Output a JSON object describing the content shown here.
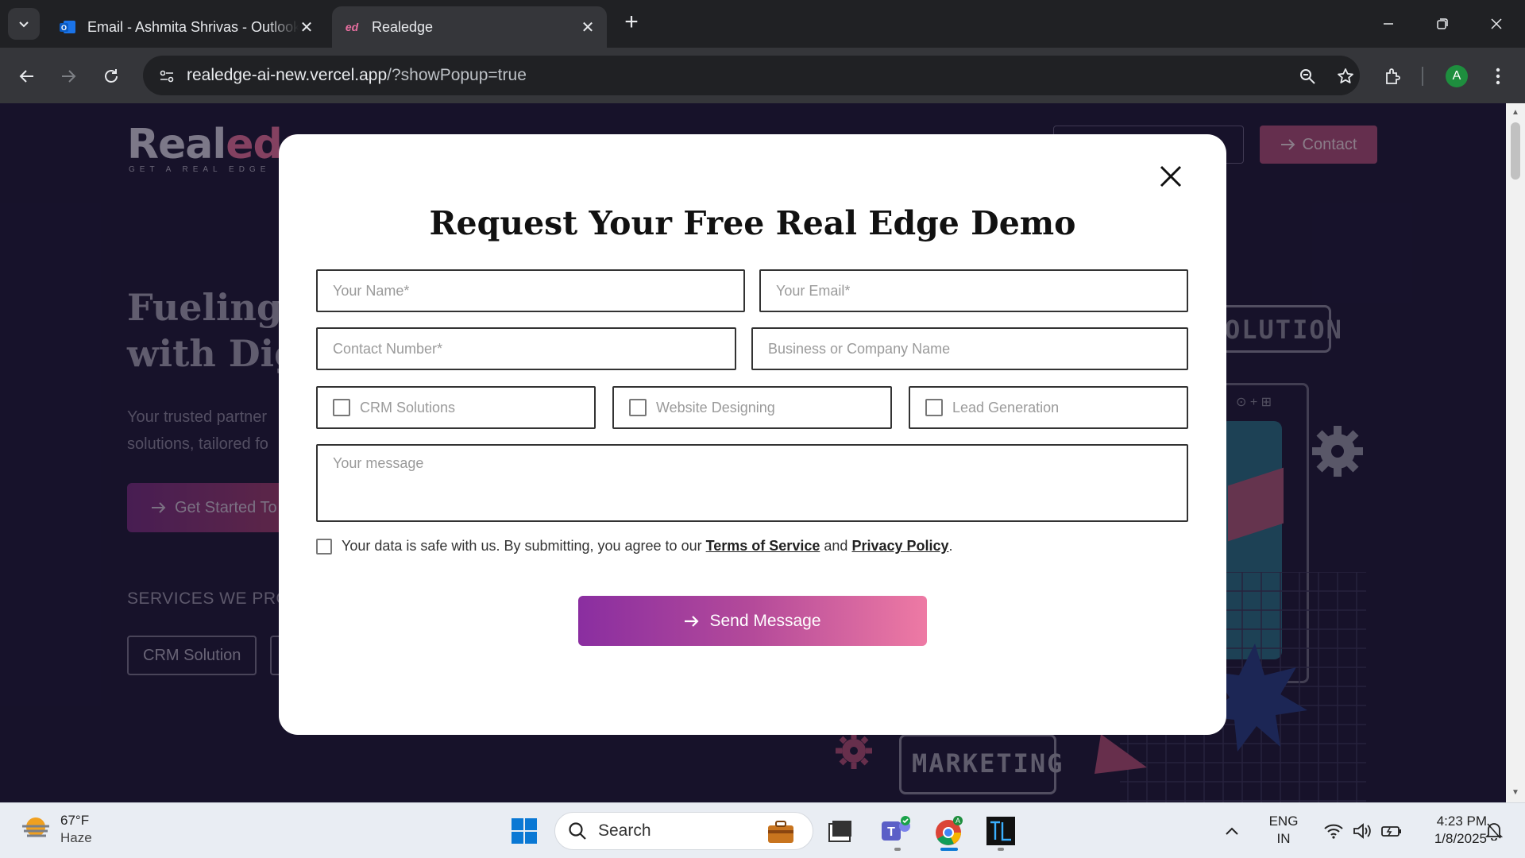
{
  "browser": {
    "tabs": [
      {
        "title": "Email - Ashmita Shrivas - Outlook",
        "active": false
      },
      {
        "title": "Realedge",
        "active": true
      }
    ],
    "url_host": "realedge-ai-new.vercel.app",
    "url_rest": "/?showPopup=true",
    "profile_initial": "A"
  },
  "site": {
    "logo_main": "Real",
    "logo_accent": "edge",
    "logo_tagline": "GET A REAL EDGE",
    "contact_label": "Contact",
    "hero_title_line1": "Fueling B",
    "hero_title_line2": "with Digi",
    "hero_sub_line1": "Your trusted partner",
    "hero_sub_line2": "solutions, tailored fo",
    "get_started_label": "Get Started To",
    "services_heading": "SERVICES WE PROV",
    "service_chip": "CRM Solution",
    "deco_solution": "OLUTION",
    "deco_marketing": "MARKETING"
  },
  "modal": {
    "title": "Request Your Free Real Edge Demo",
    "name_placeholder": "Your Name*",
    "email_placeholder": "Your Email*",
    "phone_placeholder": "Contact Number*",
    "company_placeholder": "Business or Company Name",
    "options": [
      "CRM Solutions",
      "Website Designing",
      "Lead Generation"
    ],
    "message_placeholder": "Your message",
    "consent_text": "Your data is safe with us. By submitting, you agree to our",
    "terms_label": "Terms of Service",
    "and_text": "and",
    "privacy_label": "Privacy Policy",
    "period": ".",
    "send_label": "Send Message"
  },
  "taskbar": {
    "temperature": "67°F",
    "condition": "Haze",
    "search_label": "Search",
    "lang_line1": "ENG",
    "lang_line2": "IN",
    "time": "4:23 PM",
    "date": "1/8/2025"
  },
  "colors": {
    "page_bg": "#211a3d",
    "accent_pink": "#ee7aa4",
    "accent_purple": "#8a2ea0"
  }
}
